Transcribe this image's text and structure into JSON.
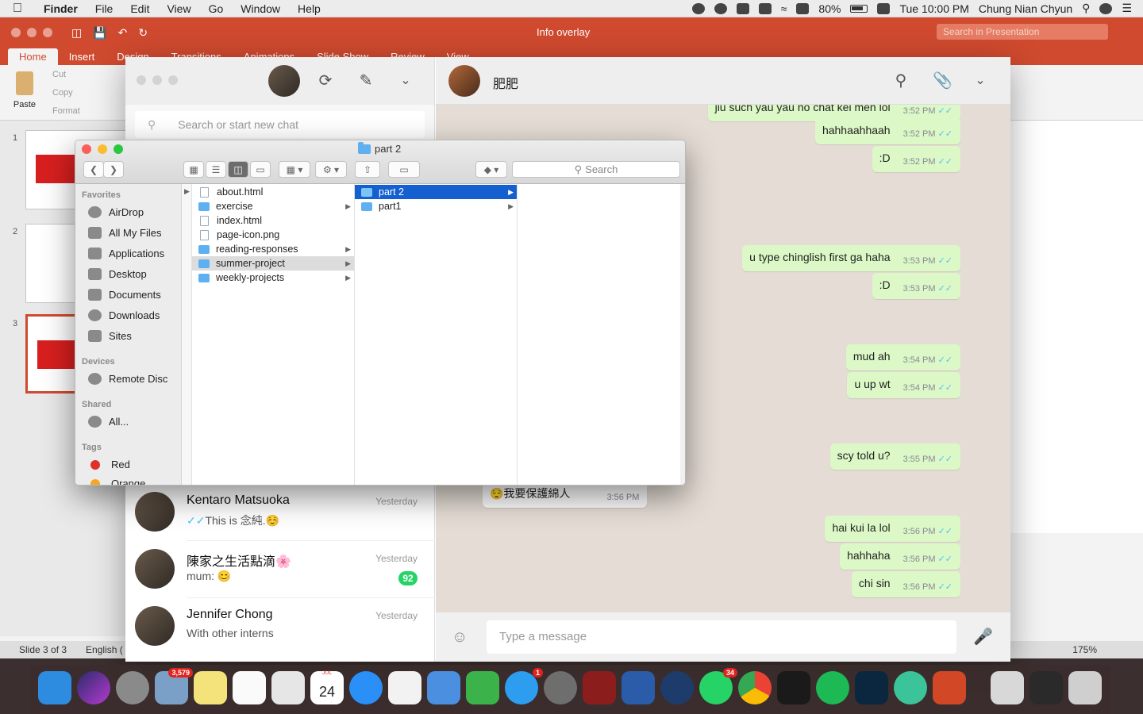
{
  "menubar": {
    "app_name": "Finder",
    "menus": [
      "File",
      "Edit",
      "View",
      "Go",
      "Window",
      "Help"
    ],
    "battery": "80%",
    "clock": "Tue 10:00 PM",
    "user": "Chung Nian Chyun"
  },
  "powerpoint": {
    "title": "Info overlay",
    "search_placeholder": "Search in Presentation",
    "tabs": [
      "Home",
      "Insert",
      "Design",
      "Transitions",
      "Animations",
      "Slide Show",
      "Review",
      "View"
    ],
    "ribbon": {
      "paste": "Paste",
      "cut": "Cut",
      "copy": "Copy",
      "format": "Format"
    },
    "slide_numbers": [
      "1",
      "2",
      "3"
    ],
    "status": {
      "slide": "Slide 3 of 3",
      "language": "English (",
      "zoom": "175%"
    },
    "colors": {
      "accent": "#d04a2f"
    }
  },
  "whatsapp": {
    "search_placeholder": "Search or start new chat",
    "current_chat": "肥肥",
    "chats": [
      {
        "name": "Kentaro Matsuoka",
        "time": "Yesterday",
        "message": "This is 念純.☺️",
        "ticks": "✓✓",
        "badge": ""
      },
      {
        "name": "陳家之生活點滴🌸",
        "time": "Yesterday",
        "message": "mum: 😊",
        "ticks": "",
        "badge": "92"
      },
      {
        "name": "Jennifer Chong",
        "time": "Yesterday",
        "message": "With other interns",
        "ticks": "",
        "badge": ""
      }
    ],
    "messages": [
      {
        "text": "jiu such yau yau no chat kei men lol",
        "time": "3:52 PM",
        "direction": "out"
      },
      {
        "text": "hahhaahhaah",
        "time": "3:52 PM",
        "direction": "out"
      },
      {
        "text": ":D",
        "time": "3:52 PM",
        "direction": "out"
      },
      {
        "text": "u type chinglish first ga haha",
        "time": "3:53 PM",
        "direction": "out"
      },
      {
        "text": ":D",
        "time": "3:53 PM",
        "direction": "out"
      },
      {
        "text": "mud ah",
        "time": "3:54 PM",
        "direction": "out"
      },
      {
        "text": "u up wt",
        "time": "3:54 PM",
        "direction": "out"
      },
      {
        "text": "scy told u?",
        "time": "3:55 PM",
        "direction": "out"
      },
      {
        "text": "😌我要保護綿人",
        "time": "3:56 PM",
        "direction": "in"
      },
      {
        "text": "hai kui la lol",
        "time": "3:56 PM",
        "direction": "out"
      },
      {
        "text": "hahhaha",
        "time": "3:56 PM",
        "direction": "out"
      },
      {
        "text": "chi sin",
        "time": "3:56 PM",
        "direction": "out"
      }
    ],
    "compose_placeholder": "Type a message",
    "colors": {
      "outgoing_bubble": "#dcf8c6",
      "badge": "#25d366"
    }
  },
  "finder": {
    "title": "part 2",
    "search_label": "Search",
    "sidebar": {
      "favorites_header": "Favorites",
      "favorites": [
        "AirDrop",
        "All My Files",
        "Applications",
        "Desktop",
        "Documents",
        "Downloads",
        "Sites"
      ],
      "devices_header": "Devices",
      "devices": [
        "Remote Disc"
      ],
      "shared_header": "Shared",
      "shared": [
        "All..."
      ],
      "tags_header": "Tags",
      "tags": [
        {
          "name": "Red",
          "color": "#e0302a"
        },
        {
          "name": "Orange",
          "color": "#f5a623"
        }
      ]
    },
    "column1": [
      {
        "name": "about.html",
        "kind": "file",
        "has_children": false
      },
      {
        "name": "exercise",
        "kind": "folder",
        "has_children": true
      },
      {
        "name": "index.html",
        "kind": "file",
        "has_children": false
      },
      {
        "name": "page-icon.png",
        "kind": "file",
        "has_children": false
      },
      {
        "name": "reading-responses",
        "kind": "folder",
        "has_children": true
      },
      {
        "name": "summer-project",
        "kind": "folder",
        "has_children": true
      },
      {
        "name": "weekly-projects",
        "kind": "folder",
        "has_children": true
      }
    ],
    "column2": [
      {
        "name": "part 2",
        "kind": "folder",
        "has_children": true
      },
      {
        "name": "part1",
        "kind": "folder",
        "has_children": true
      }
    ],
    "selected_col1": "summer-project",
    "selected_col2": "part 2"
  },
  "dock": {
    "badges": {
      "mail": "3,579",
      "calendar_day": "24",
      "calendar_month": "JUL",
      "app_store": "1",
      "whatsapp": "34"
    }
  }
}
